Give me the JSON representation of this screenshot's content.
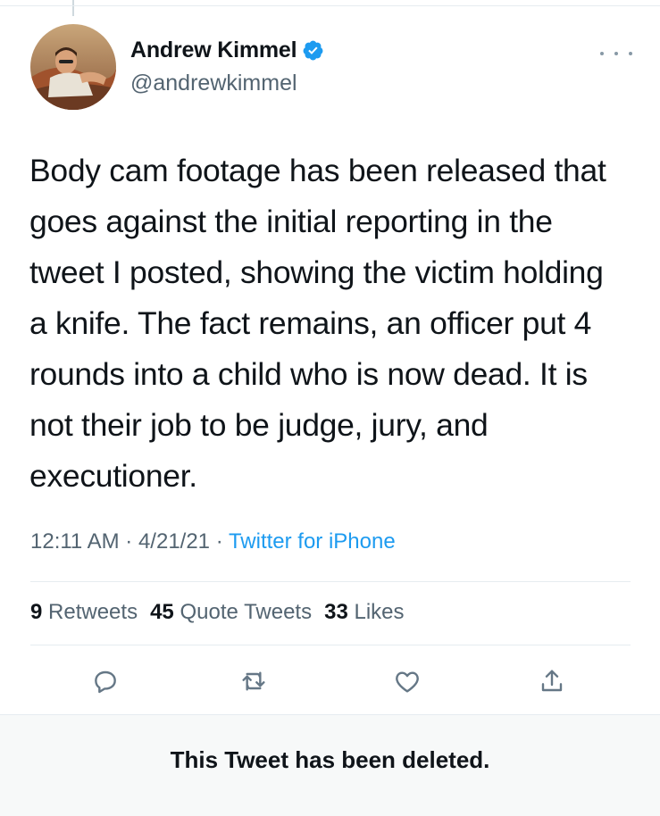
{
  "tweet": {
    "author": {
      "display_name": "Andrew Kimmel",
      "handle": "@andrewkimmel",
      "verified": true
    },
    "text": "Body cam footage has been released that goes against the initial reporting in the tweet I posted, showing the victim holding a knife. The fact remains, an officer put 4 rounds into a child who is now dead. It is not their job to be judge, jury, and executioner.",
    "meta": {
      "time": "12:11 AM",
      "date": "4/21/21",
      "separator": " · ",
      "source": "Twitter for iPhone"
    },
    "stats": {
      "retweets_count": "9",
      "retweets_label": "Retweets",
      "quote_tweets_count": "45",
      "quote_tweets_label": "Quote Tweets",
      "likes_count": "33",
      "likes_label": "Likes"
    },
    "actions": [
      "reply-icon",
      "retweet-icon",
      "like-icon",
      "share-icon"
    ]
  },
  "notice": {
    "text": "This Tweet has been deleted."
  },
  "colors": {
    "accent": "#1d9bf0",
    "secondary_text": "#536471",
    "icon": "#657786",
    "footer_bg": "#f7f9f9"
  }
}
